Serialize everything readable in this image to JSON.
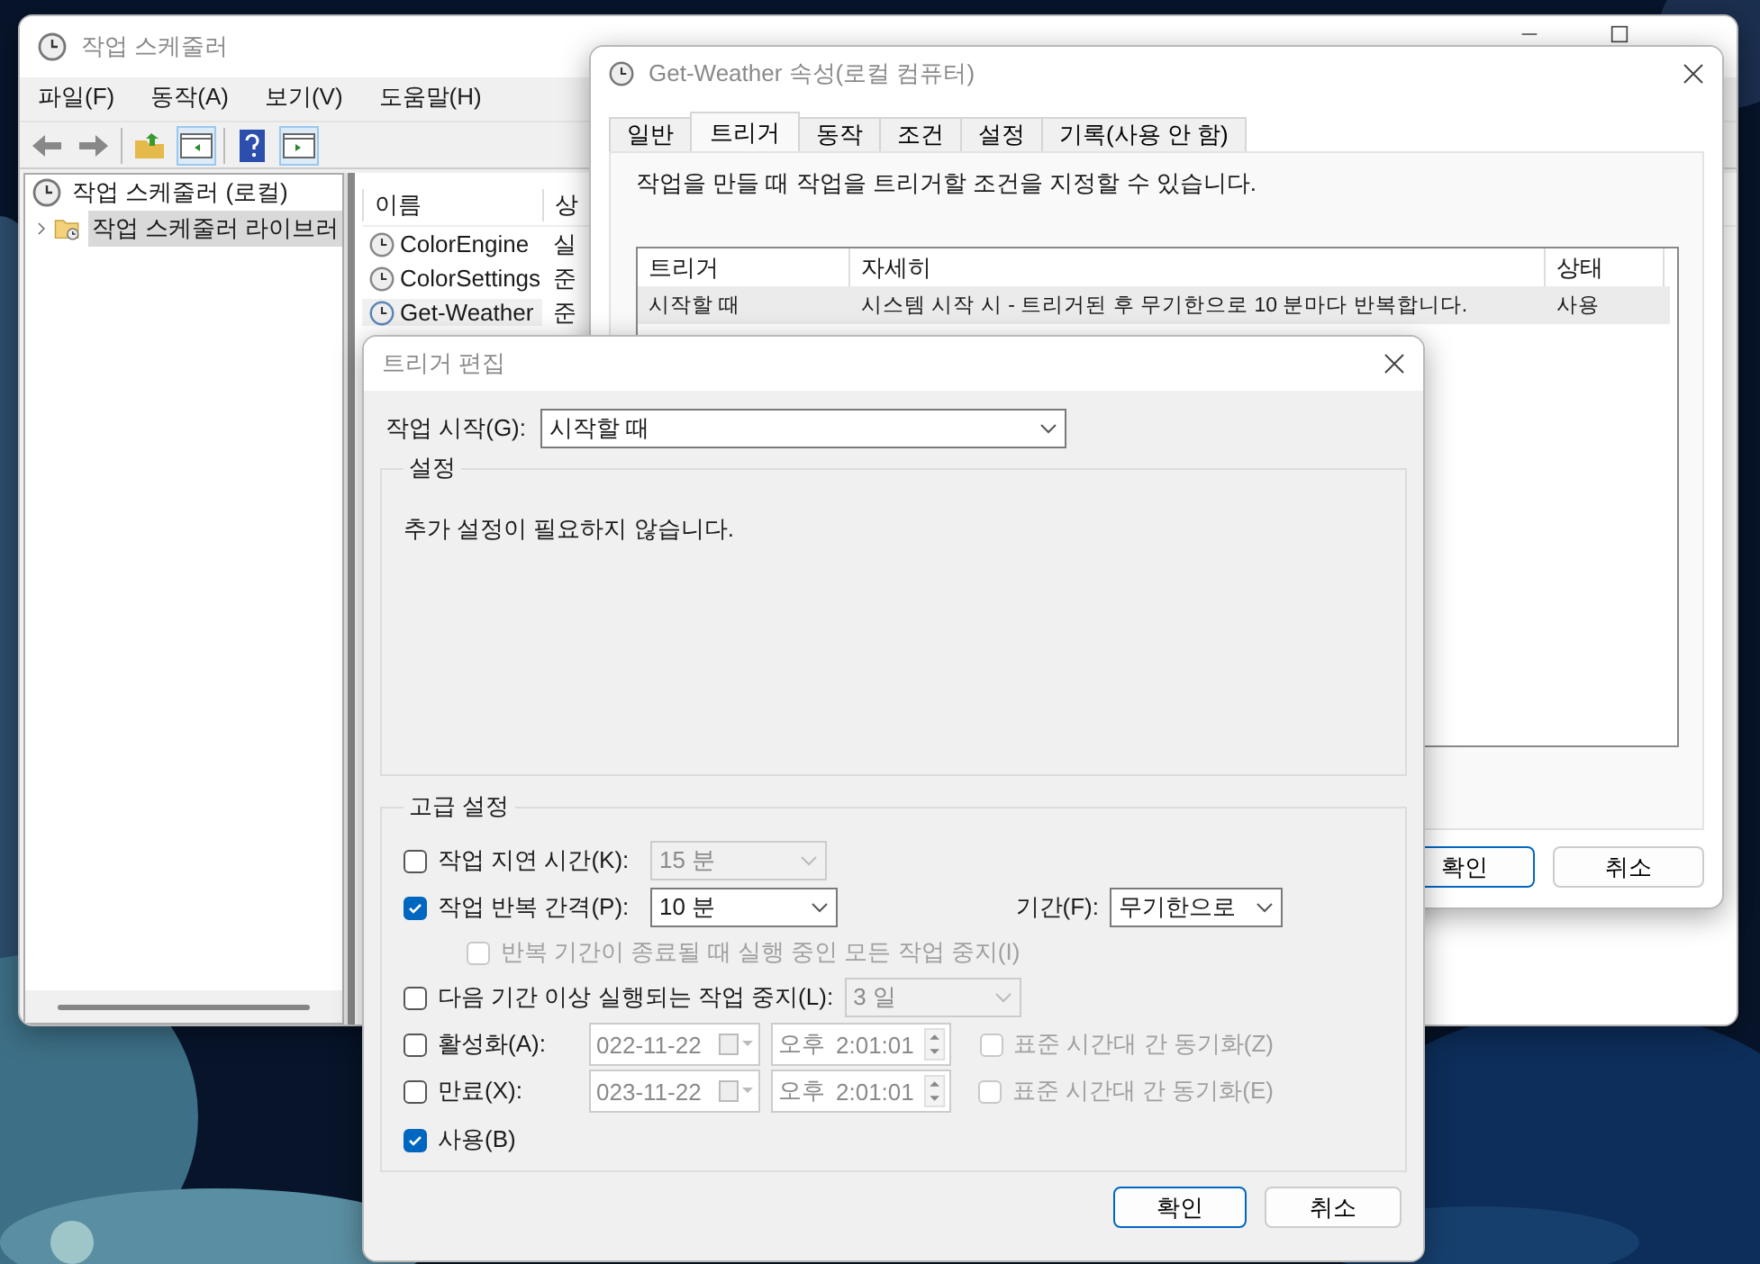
{
  "main_window": {
    "title": "작업 스케줄러",
    "menu": [
      "파일(F)",
      "동작(A)",
      "보기(V)",
      "도움말(H)"
    ],
    "tree": [
      {
        "label": "작업 스케줄러 (로컬)",
        "selected": false,
        "children": [
          {
            "label": "작업 스케줄러 라이브러",
            "selected": true,
            "expanded": false
          }
        ]
      }
    ],
    "task_list": {
      "columns": [
        "이름",
        "상"
      ],
      "rows": [
        {
          "name": "ColorEngine",
          "status": "실",
          "selected": false
        },
        {
          "name": "ColorSettings",
          "status": "준",
          "selected": false
        },
        {
          "name": "Get-Weather",
          "status": "준",
          "selected": true
        }
      ]
    }
  },
  "properties": {
    "title": "Get-Weather 속성(로컬 컴퓨터)",
    "tabs": [
      {
        "label": "일반",
        "selected": false
      },
      {
        "label": "트리거",
        "selected": true
      },
      {
        "label": "동작",
        "selected": false
      },
      {
        "label": "조건",
        "selected": false
      },
      {
        "label": "설정",
        "selected": false
      },
      {
        "label": "기록(사용 안 함)",
        "selected": false
      }
    ],
    "description": "작업을 만들 때 작업을 트리거할 조건을 지정할 수 있습니다.",
    "triggers": {
      "columns": [
        "트리거",
        "자세히",
        "상태"
      ],
      "rows": [
        {
          "trigger": "시작할 때",
          "details": "시스템 시작 시 - 트리거된 후 무기한으로 10 분마다 반복합니다.",
          "status": "사용",
          "selected": true
        }
      ]
    },
    "buttons": [
      "확인",
      "취소"
    ]
  },
  "edit_trigger": {
    "title": "트리거 편집",
    "start": {
      "label": "작업 시작(G):",
      "value": "시작할 때"
    },
    "settings": {
      "title": "설정",
      "message": "추가 설정이 필요하지 않습니다."
    },
    "advanced": {
      "title": "고급 설정",
      "options": [
        {
          "kind": "combo",
          "label": "작업 지연 시간(K):",
          "checked": false,
          "value": "15 분"
        },
        {
          "kind": "combo",
          "label": "작업 반복 간격(P):",
          "checked": true,
          "value": "10 분",
          "extra": {
            "label": "기간(F):",
            "value": "무기한으로"
          }
        },
        {
          "kind": "sub_check",
          "label": "반복 기간이 종료될 때 실행 중인 모든 작업 중지(I)",
          "checked": false,
          "disabled": true
        },
        {
          "kind": "combo",
          "label": "다음 기간 이상 실행되는 작업 중지(L):",
          "checked": false,
          "value": "3 일"
        },
        {
          "kind": "datetime",
          "label": "활성화(A):",
          "checked": false,
          "date": "022-11-22",
          "period": "오후",
          "time": "2:01:01",
          "sync": {
            "label": "표준 시간대 간 동기화(Z)",
            "checked": false,
            "disabled": true
          }
        },
        {
          "kind": "datetime",
          "label": "만료(X):",
          "checked": false,
          "date": "023-11-22",
          "period": "오후",
          "time": "2:01:01",
          "sync": {
            "label": "표준 시간대 간 동기화(E)",
            "checked": false,
            "disabled": true
          }
        },
        {
          "kind": "check",
          "label": "사용(B)",
          "checked": true
        }
      ]
    },
    "buttons": [
      "확인",
      "취소"
    ]
  }
}
